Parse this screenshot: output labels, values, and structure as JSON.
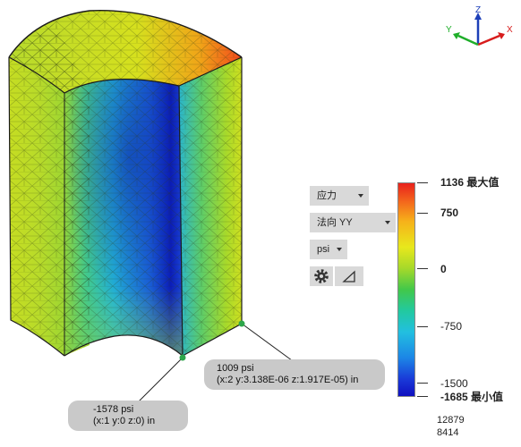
{
  "toolbar": {
    "result_type": "应力",
    "component": "法向 YY",
    "unit": "psi"
  },
  "legend": {
    "max_label": "1136 最大值",
    "min_label": "-1685 最小值",
    "ticks": [
      "750",
      "0",
      "-750",
      "-1500"
    ]
  },
  "stats": {
    "line1": "12879",
    "line2": "8414"
  },
  "probes": [
    {
      "value": "1009 psi",
      "coords": "(x:2 y:3.138E-06 z:1.917E-05) in"
    },
    {
      "value": "-1578 psi",
      "coords": "(x:1 y:0 z:0) in"
    }
  ],
  "triad": {
    "z": "Z",
    "y": "Y",
    "x": "X"
  },
  "colors": {
    "x_axis": "#d81c1c",
    "y_axis": "#1fae2a",
    "z_axis": "#1d3fb8",
    "panel": "#d9d9d9",
    "probe_bg": "#c9c9c9",
    "probe_marker": "#2da64a"
  }
}
